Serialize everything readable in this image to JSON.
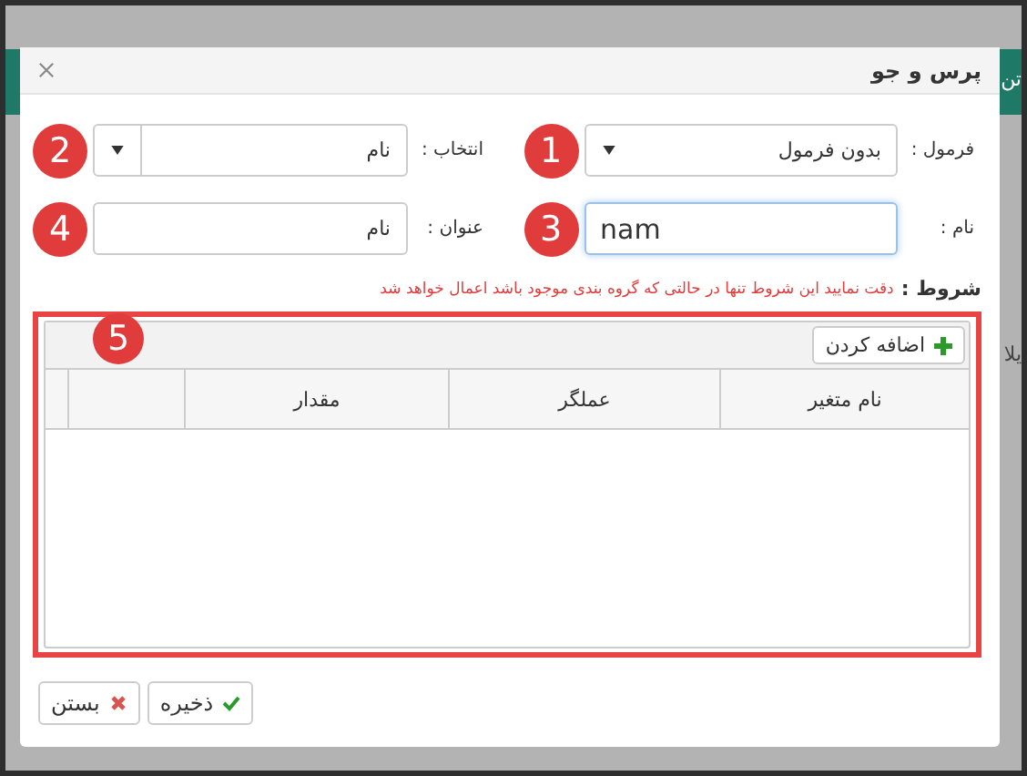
{
  "background": {
    "header_fragment": "تن",
    "side_fragment": "یلا"
  },
  "window": {
    "title": "پرس و جو"
  },
  "fields": [
    {
      "kind": "select",
      "label": "فرمول :",
      "value": "بدون فرمول",
      "focused": false,
      "badge": "1"
    },
    {
      "kind": "split-select",
      "label": "انتخاب :",
      "value": "نام",
      "focused": false,
      "badge": "2"
    },
    {
      "kind": "text",
      "label": "نام :",
      "value": "nam",
      "focused": true,
      "badge": "3"
    },
    {
      "kind": "text",
      "label": "عنوان :",
      "value": "نام",
      "focused": false,
      "badge": "4"
    }
  ],
  "conditions": {
    "label": "شروط :",
    "notice": "دقت نمایید این شروط تنها در حالتی که گروه بندی موجود باشد اعمال خواهد شد",
    "badge": "5",
    "add_button": "اضافه کردن",
    "columns": [
      "نام متغیر",
      "عملگر",
      "مقدار"
    ]
  },
  "buttons": [
    {
      "kind": "save",
      "label": "ذخیره"
    },
    {
      "kind": "close",
      "label": "بستن"
    }
  ]
}
